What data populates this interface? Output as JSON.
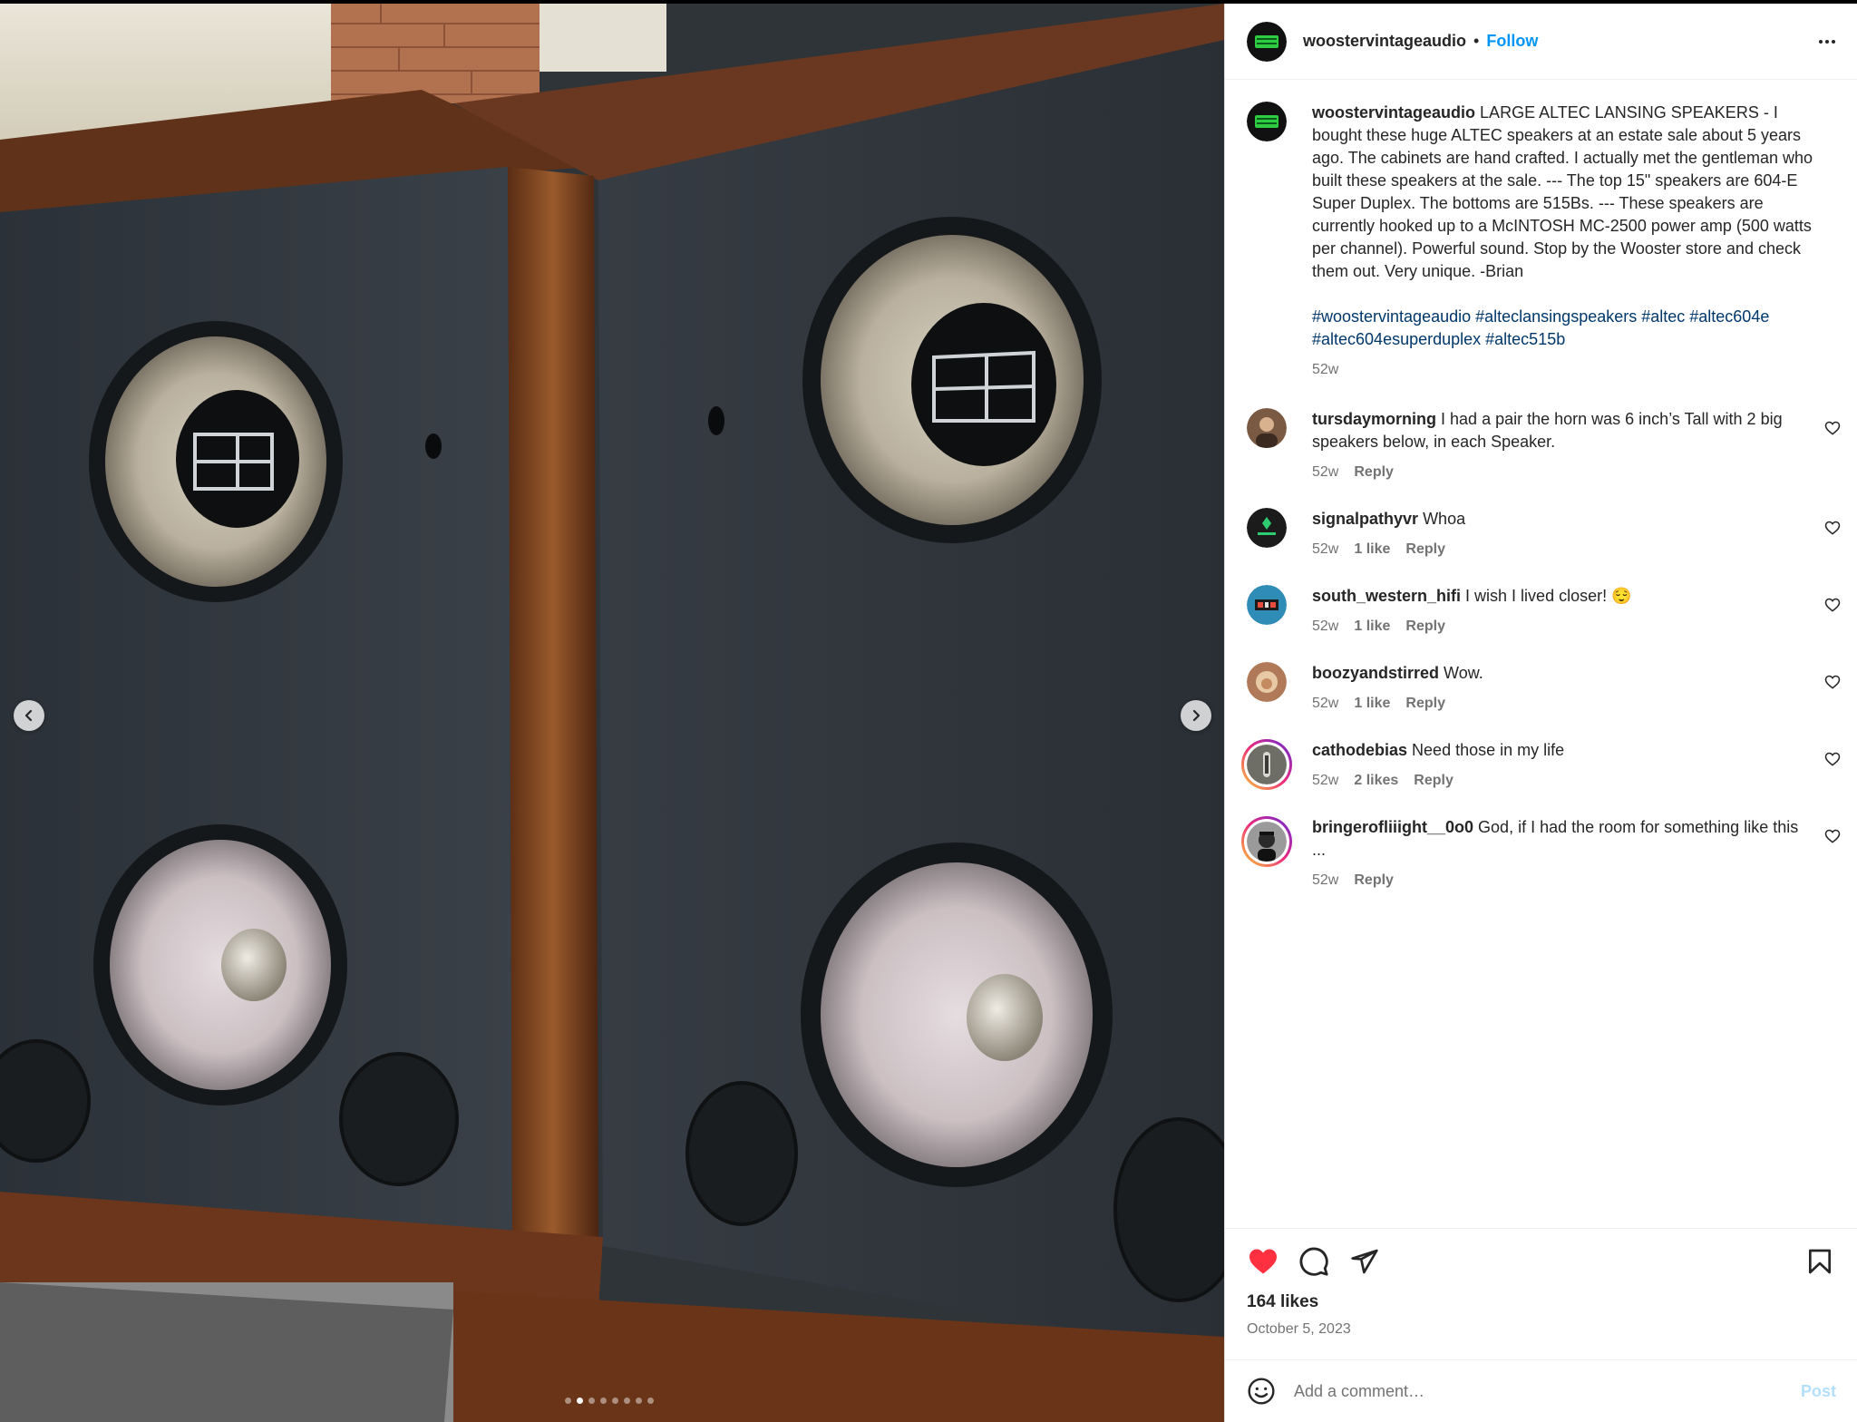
{
  "post": {
    "author": "woostervintageaudio",
    "follow_label": "Follow",
    "separator": "•",
    "more_icon": "more-horizontal-icon",
    "caption_text": "LARGE ALTEC LANSING SPEAKERS - I bought these huge ALTEC speakers at an estate sale about 5 years ago. The cabinets are hand crafted. I actually met the gentleman who built these speakers at the sale. --- The top 15\" speakers are 604-E Super Duplex. The bottoms are 515Bs. --- These speakers are currently hooked up to a McINTOSH MC-2500 power amp (500 watts per channel). Powerful sound. Stop by the Wooster store and check them out. Very unique. -Brian",
    "hashtags": "#woostervintageaudio #alteclansingspeakers #altec #altec604e #altec604esuperduplex #altec515b",
    "caption_time": "52w",
    "avatar_logo_text": "WOOSTER VINTAGE"
  },
  "media": {
    "slide_count": 8,
    "active_slide": 1,
    "prev_icon": "chevron-left-icon",
    "next_icon": "chevron-right-icon"
  },
  "comments": [
    {
      "user": "tursdaymorning",
      "text": "I had a pair the horn was 6 inch’s Tall with 2 big speakers below, in each Speaker.",
      "time": "52w",
      "likes": "",
      "reply": "Reply",
      "story": false
    },
    {
      "user": "signalpathyvr",
      "text": "Whoa",
      "time": "52w",
      "likes": "1 like",
      "reply": "Reply",
      "story": false
    },
    {
      "user": "south_western_hifi",
      "text": "I wish I lived closer! 😌",
      "time": "52w",
      "likes": "1 like",
      "reply": "Reply",
      "story": false
    },
    {
      "user": "boozyandstirred",
      "text": "Wow.",
      "time": "52w",
      "likes": "1 like",
      "reply": "Reply",
      "story": false
    },
    {
      "user": "cathodebias",
      "text": "Need those in my life",
      "time": "52w",
      "likes": "2 likes",
      "reply": "Reply",
      "story": true
    },
    {
      "user": "bringerofliiight__0o0",
      "text": "God, if I had the room for something like this ...",
      "time": "52w",
      "likes": "",
      "reply": "Reply",
      "story": true
    }
  ],
  "actions": {
    "like_icon": "heart-filled-icon",
    "comment_icon": "comment-icon",
    "share_icon": "send-icon",
    "save_icon": "bookmark-icon",
    "likes": "164 likes",
    "date": "October 5, 2023",
    "like_color": "#ff3040"
  },
  "composer": {
    "placeholder": "Add a comment…",
    "post_label": "Post",
    "emoji_icon": "emoji-icon"
  },
  "colors": {
    "link": "#0095f6",
    "hashtag": "#00376b",
    "muted": "#737373"
  }
}
